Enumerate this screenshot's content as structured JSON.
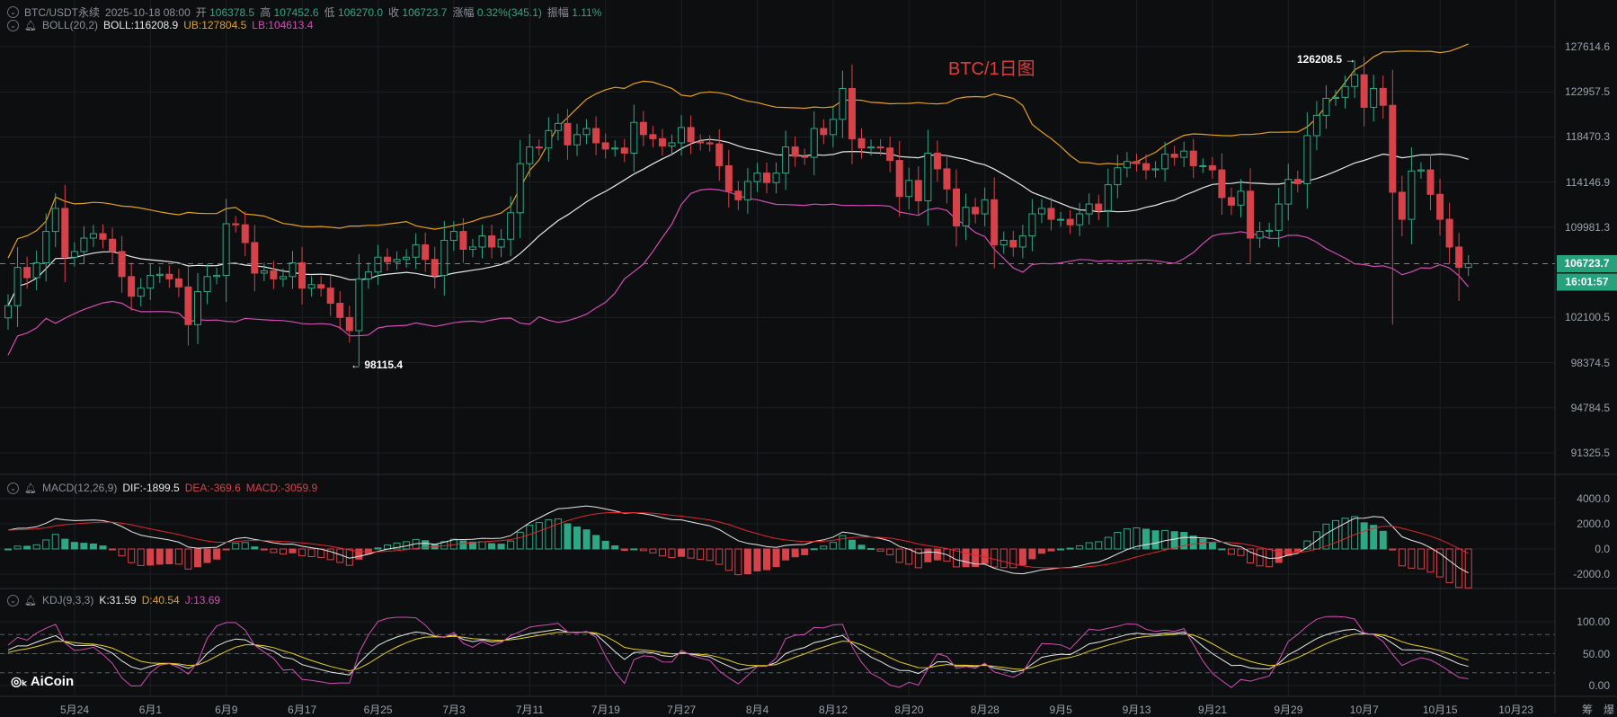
{
  "header": {
    "symbol": "BTC/USDT永续",
    "datetime": "2025-10-18 08:00",
    "open_label": "开",
    "open": "106378.5",
    "high_label": "高",
    "high": "107452.6",
    "low_label": "低",
    "low": "106270.0",
    "close_label": "收",
    "close": "106723.7",
    "change_label": "涨幅",
    "change": "0.32%(345.1)",
    "amp_label": "振幅",
    "amp": "1.11%"
  },
  "boll": {
    "name": "BOLL(20,2)",
    "mid": "BOLL:116208.9",
    "ub": "UB:127804.5",
    "lb": "LB:104613.4"
  },
  "macd": {
    "name": "MACD(12,26,9)",
    "dif": "DIF:-1899.5",
    "dea": "DEA:-369.6",
    "macd": "MACD:-3059.9"
  },
  "kdj": {
    "name": "KDJ(9,3,3)",
    "k": "K:31.59",
    "d": "D:40.54",
    "j": "J:13.69"
  },
  "chart_title": "BTC/1日图",
  "annotations": {
    "high": "126208.5",
    "low": "98115.4"
  },
  "price_axis": [
    "127614.6",
    "122957.5",
    "118470.3",
    "114146.9",
    "109981.3",
    "102100.5",
    "98374.5",
    "94784.5",
    "91325.5"
  ],
  "current_price": "106723.7",
  "countdown": "16:01:57",
  "macd_axis": [
    "4000.0",
    "2000.0",
    "0.0",
    "-2000.0"
  ],
  "kdj_axis": [
    "100.00",
    "50.00",
    "0.00"
  ],
  "date_axis": [
    "5月24",
    "6月1",
    "6月9",
    "6月17",
    "6月25",
    "7月3",
    "7月11",
    "7月19",
    "7月27",
    "8月4",
    "8月12",
    "8月20",
    "8月28",
    "9月5",
    "9月13",
    "9月21",
    "9月29",
    "10月7",
    "10月15",
    "10月23"
  ],
  "footer": {
    "chips": "筹",
    "liq": "爆"
  },
  "logo": "AiCoin",
  "colors": {
    "up": "#2ea784",
    "down": "#d6424a",
    "mid": "#e8e8e8",
    "ub": "#e6a018",
    "lb": "#d24cb4",
    "dea": "#e0262e",
    "d": "#e6d018",
    "j": "#d24cb4",
    "bg": "#0d0e10",
    "grid": "#1d1f23"
  },
  "chart_data": {
    "type": "candlestick",
    "start_date": "2025-05-17",
    "closes": [
      103.1,
      106.4,
      105.5,
      106.8,
      109.6,
      111.7,
      107.3,
      107.8,
      109.0,
      109.4,
      108.9,
      107.8,
      105.6,
      103.9,
      104.6,
      105.7,
      105.8,
      105.4,
      104.7,
      101.5,
      104.3,
      105.6,
      105.7,
      110.3,
      110.2,
      108.6,
      105.9,
      106.1,
      105.4,
      105.6,
      106.8,
      104.6,
      104.9,
      104.6,
      103.3,
      102.1,
      101.0,
      105.4,
      106.0,
      107.3,
      106.9,
      107.1,
      107.3,
      108.4,
      107.1,
      105.7,
      108.8,
      109.6,
      108.0,
      108.2,
      109.2,
      108.2,
      108.9,
      111.3,
      115.9,
      117.5,
      117.4,
      119.1,
      119.8,
      117.7,
      118.7,
      119.3,
      117.9,
      117.3,
      117.4,
      116.9,
      119.9,
      118.7,
      118.3,
      117.6,
      117.9,
      119.4,
      118.0,
      117.9,
      117.8,
      115.7,
      113.3,
      112.5,
      114.2,
      115.0,
      114.1,
      115.0,
      117.5,
      116.6,
      116.5,
      119.3,
      118.7,
      120.2,
      123.3,
      118.3,
      117.4,
      117.5,
      117.4,
      116.2,
      112.8,
      114.3,
      112.4,
      116.9,
      115.4,
      113.5,
      110.1,
      111.8,
      111.2,
      112.5,
      108.4,
      108.8,
      108.2,
      109.2,
      111.2,
      111.7,
      110.7,
      110.7,
      110.2,
      111.2,
      112.1,
      111.5,
      113.9,
      115.5,
      116.1,
      115.9,
      115.3,
      115.4,
      116.8,
      116.5,
      117.1,
      115.7,
      115.7,
      115.3,
      112.7,
      112.0,
      113.3,
      109.0,
      109.6,
      109.7,
      112.1,
      114.4,
      114.0,
      118.6,
      120.6,
      122.3,
      122.4,
      123.5,
      124.7,
      121.4,
      123.3,
      121.6,
      113.2,
      110.7,
      115.2,
      115.3,
      113.0,
      110.7,
      108.2,
      106.4,
      106.7237
    ],
    "close_unit": "thousand USDT",
    "wick_overrides": {
      "37": {
        "low": 98.1154
      },
      "142": {
        "high": 126.2085
      },
      "146": {
        "low": 101.5
      },
      "153": {
        "low": 103.5
      }
    },
    "price_range": [
      91325.5,
      127614.6
    ],
    "scale": "log"
  }
}
